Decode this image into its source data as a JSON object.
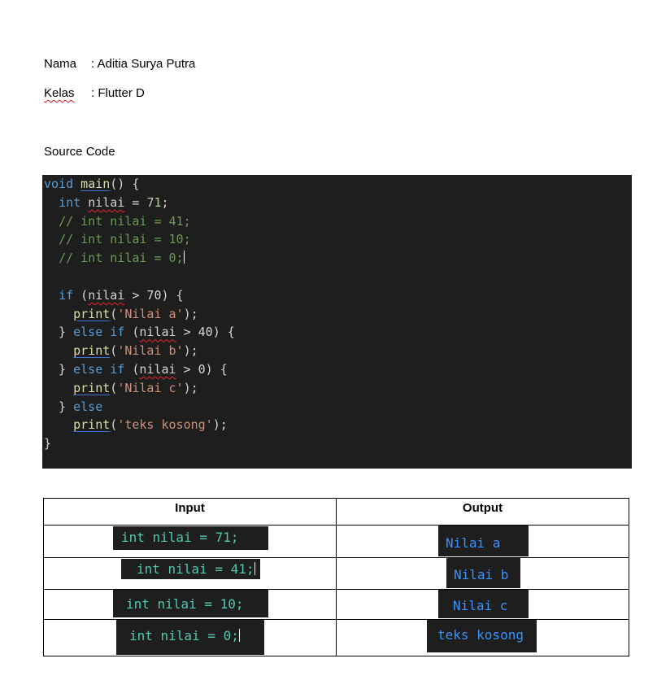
{
  "header": {
    "nama_label": "Nama",
    "nama_value": ": Aditia  Surya Putra",
    "kelas_label": "Kelas",
    "kelas_value": ": Flutter D"
  },
  "source_heading": "Source Code",
  "code": {
    "kw_void": "void",
    "fn_main": "main",
    "main_sig": "() {",
    "kw_int": "int",
    "var_nilai": "nilai",
    "assign_71": " = ",
    "num_71": "71",
    "semi": ";",
    "comment_41": "// int nilai = 41;",
    "comment_10": "// int nilai = 10;",
    "comment_0": "// int nilai = 0;",
    "kw_if": "if",
    "cond_70": " > 70) {",
    "fn_print": "print",
    "str_a": "'Nilai a'",
    "str_b": "'Nilai b'",
    "str_c": "'Nilai c'",
    "str_kosong": "'teks kosong'",
    "kw_else": "else",
    "cond_40": " > 40) {",
    "cond_0": " > 0) {",
    "close_brace": "}"
  },
  "table": {
    "header_input": "Input",
    "header_output": "Output",
    "rows": [
      {
        "input": "int nilai = 71;",
        "output": "Nilai a"
      },
      {
        "input": "int nilai = 41;",
        "output": "Nilai b"
      },
      {
        "input": "int nilai = 10;",
        "output": "Nilai c"
      },
      {
        "input": "int nilai = 0;",
        "output": "teks kosong"
      }
    ]
  }
}
